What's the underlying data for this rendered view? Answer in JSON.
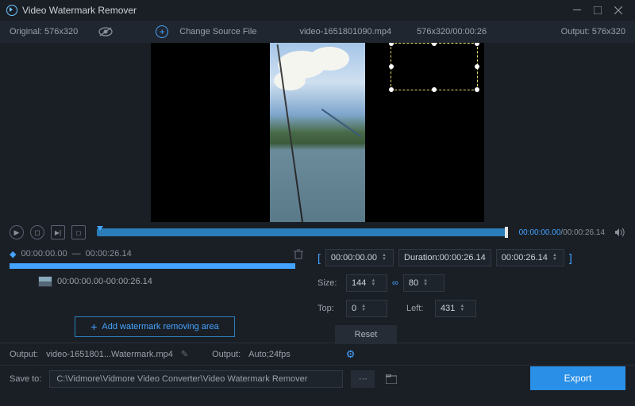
{
  "app": {
    "title": "Video Watermark Remover"
  },
  "topbar": {
    "original_label": "Original:",
    "original_dim": "576x320",
    "change_source": "Change Source File",
    "filename": "video-1651801090.mp4",
    "dim_dur": "576x320/00:00:26",
    "output_label": "Output:",
    "output_dim": "576x320"
  },
  "timeline": {
    "current": "00:00:00.00",
    "duration": "00:00:26.14"
  },
  "segment": {
    "start": "00:00:00.00",
    "end": "00:00:26.14",
    "range_text": "00:00:00.00-00:00:26.14"
  },
  "add_area_label": "Add watermark removing area",
  "range": {
    "start": "00:00:00.00",
    "duration_label": "Duration:",
    "duration": "00:00:26.14",
    "end": "00:00:26.14"
  },
  "size": {
    "label": "Size:",
    "w": "144",
    "h": "80"
  },
  "pos": {
    "top_label": "Top:",
    "top": "0",
    "left_label": "Left:",
    "left": "431"
  },
  "reset_label": "Reset",
  "output": {
    "label": "Output:",
    "file": "video-1651801...Watermark.mp4",
    "settings_label": "Output:",
    "settings_value": "Auto;24fps"
  },
  "save": {
    "label": "Save to:",
    "path": "C:\\Vidmore\\Vidmore Video Converter\\Video Watermark Remover"
  },
  "export_label": "Export"
}
